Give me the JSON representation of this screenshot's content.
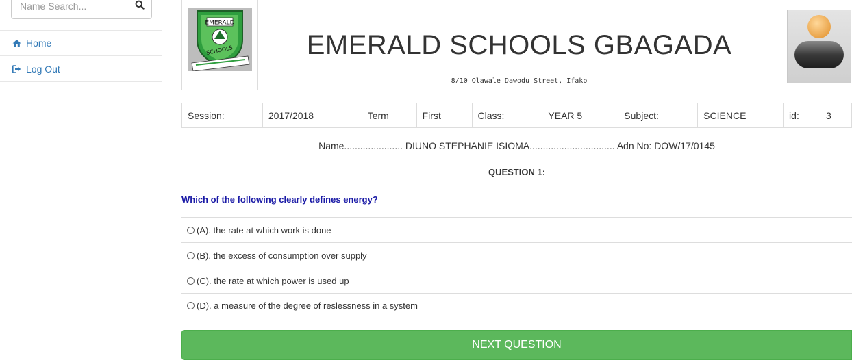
{
  "sidebar": {
    "search_placeholder": "Name Search...",
    "items": [
      {
        "label": "Home",
        "icon": "home-icon"
      },
      {
        "label": "Log Out",
        "icon": "logout-icon"
      }
    ]
  },
  "header": {
    "school_name": "EMERALD SCHOOLS GBAGADA",
    "address": "8/10 Olawale Dawodu Street, Ifako",
    "logo_text_top": "EMERALD",
    "logo_text_bottom": "SCHOOLS"
  },
  "info": {
    "session_label": "Session:",
    "session_value": "2017/2018",
    "term_label": "Term",
    "term_value": "First",
    "class_label": "Class:",
    "class_value": "YEAR 5",
    "subject_label": "Subject:",
    "subject_value": "SCIENCE",
    "id_label": "id:",
    "id_value": "3"
  },
  "student": {
    "line": "Name...................... DIUNO STEPHANIE ISIOMA................................ Adn No: DOW/17/0145"
  },
  "question": {
    "title": "QUESTION 1:",
    "text": "Which of the following clearly defines energy?",
    "options": [
      {
        "label": "(A). the rate at which work is done"
      },
      {
        "label": " (B). the excess of consumption over supply"
      },
      {
        "label": " (C). the rate at which power is used up"
      },
      {
        "label": " (D). a measure of the degree of reslessness in a system"
      }
    ]
  },
  "actions": {
    "next_label": "NEXT QUESTION"
  },
  "colors": {
    "link": "#337ab7",
    "question": "#1a1aa6",
    "next_button": "#5cb85c"
  }
}
